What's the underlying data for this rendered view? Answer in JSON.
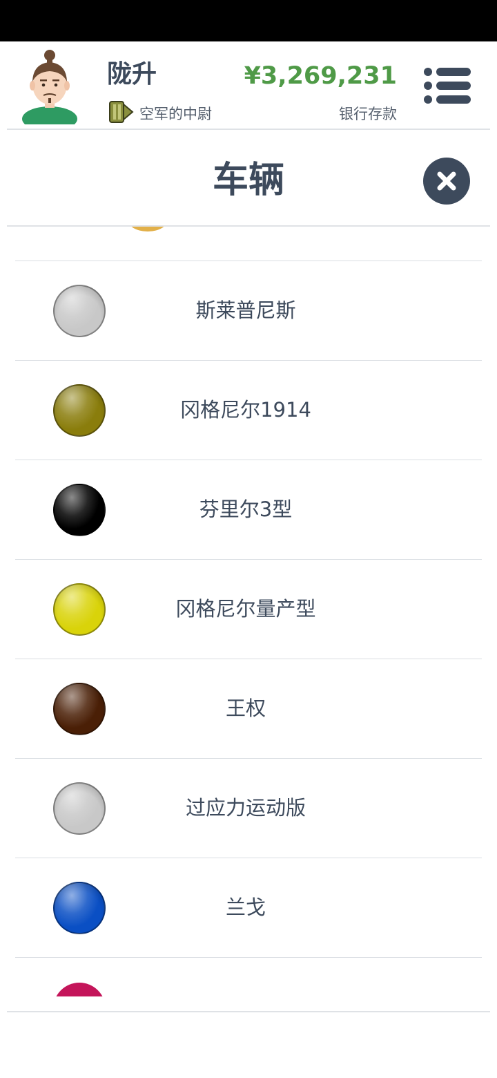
{
  "player": {
    "name": "陇升",
    "rank": "空军的中尉",
    "avatar_icon": "avatar-icon",
    "rank_icon": "rank-insignia-icon"
  },
  "bank": {
    "balance": "¥3,269,231",
    "label": "银行存款"
  },
  "page": {
    "title": "车辆"
  },
  "vehicles": [
    {
      "name": "斯莱普尼斯",
      "color": "#c8c8c8"
    },
    {
      "name": "冈格尼尔1914",
      "color": "#8a7d0c"
    },
    {
      "name": "芬里尔3型",
      "color": "#000000"
    },
    {
      "name": "冈格尼尔量产型",
      "color": "#d9d30a"
    },
    {
      "name": "王权",
      "color": "#4a1f06"
    },
    {
      "name": "过应力运动版",
      "color": "#c8c8c8"
    },
    {
      "name": "兰戈",
      "color": "#0a4fc4"
    }
  ],
  "colors": {
    "accent_text": "#3d4a5c",
    "balance_green": "#4f9a47"
  }
}
